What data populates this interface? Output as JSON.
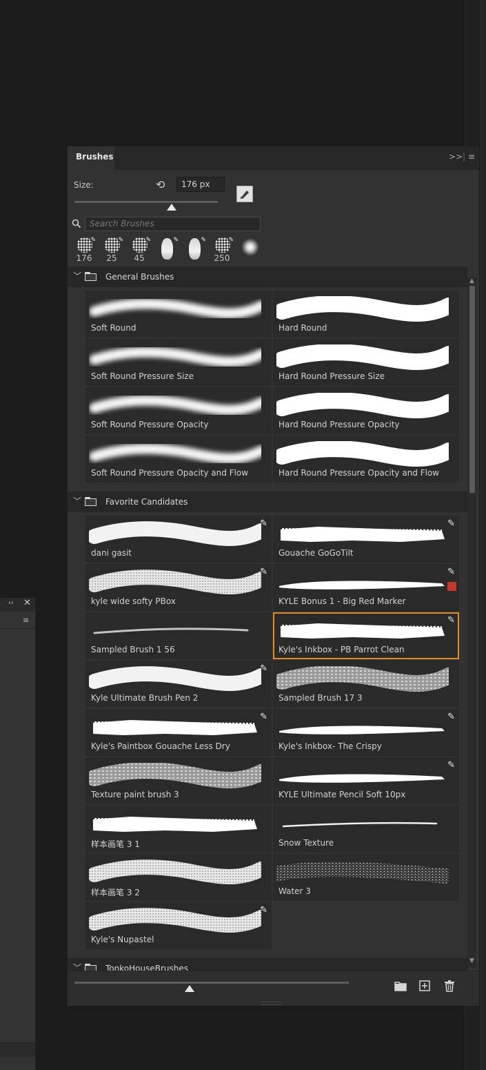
{
  "panel": {
    "title": "Brushes",
    "expand_symbol": ">>",
    "divider_symbol": "|",
    "menu_symbol": "≡"
  },
  "size": {
    "label": "Size:",
    "value": "176 px",
    "slider_fraction": 0.68
  },
  "search": {
    "placeholder": "Search Brushes"
  },
  "recent_brushes": [
    {
      "size": "176",
      "icon": "splatter-brush-icon"
    },
    {
      "size": "25",
      "icon": "splatter-brush-icon"
    },
    {
      "size": "45",
      "icon": "scatter-brush-icon"
    },
    {
      "size": "",
      "icon": "bristle-brush-icon"
    },
    {
      "size": "",
      "icon": "bristle-brush-icon"
    },
    {
      "size": "250",
      "icon": "leaf-brush-icon"
    },
    {
      "size": "",
      "icon": "soft-round-brush-icon"
    }
  ],
  "groups": [
    {
      "name": "General Brushes",
      "brushes": [
        {
          "name": "Soft Round",
          "style": "soft",
          "pen": false
        },
        {
          "name": "Hard Round",
          "style": "hard",
          "pen": false
        },
        {
          "name": "Soft Round Pressure Size",
          "style": "soft",
          "pen": false
        },
        {
          "name": "Hard Round Pressure Size",
          "style": "hard",
          "pen": false
        },
        {
          "name": "Soft Round Pressure Opacity",
          "style": "soft",
          "pen": false
        },
        {
          "name": "Hard Round Pressure Opacity",
          "style": "hard",
          "pen": false
        },
        {
          "name": "Soft Round Pressure Opacity and Flow",
          "style": "soft",
          "pen": false
        },
        {
          "name": "Hard Round Pressure Opacity and Flow",
          "style": "hard",
          "pen": false
        }
      ]
    },
    {
      "name": "Favorite Candidates",
      "brushes": [
        {
          "name": "dani gasit",
          "style": "marker",
          "pen": true
        },
        {
          "name": "Gouache GoGoTilt",
          "style": "rough",
          "pen": true
        },
        {
          "name": "kyle wide softy PBox",
          "style": "grainy",
          "pen": true
        },
        {
          "name": "KYLE Bonus 1 - Big Red Marker",
          "style": "taper",
          "pen": true,
          "red": true
        },
        {
          "name": "Sampled Brush 1 56",
          "style": "thin",
          "pen": false
        },
        {
          "name": "Kyle's Inkbox - PB Parrot Clean",
          "style": "rough",
          "pen": true,
          "selected": true
        },
        {
          "name": "Kyle Ultimate Brush Pen 2",
          "style": "marker",
          "pen": true
        },
        {
          "name": "Sampled Brush 17 3",
          "style": "texture",
          "pen": false
        },
        {
          "name": "Kyle's Paintbox Gouache Less Dry",
          "style": "rough",
          "pen": true
        },
        {
          "name": "Kyle's Inkbox- The Crispy",
          "style": "taper",
          "pen": true
        },
        {
          "name": "Texture paint brush 3",
          "style": "texture",
          "pen": false
        },
        {
          "name": "KYLE Ultimate Pencil Soft 10px",
          "style": "taper",
          "pen": true
        },
        {
          "name": "样本画笔 3 1",
          "style": "rough",
          "pen": false
        },
        {
          "name": "Snow Texture",
          "style": "hairline",
          "pen": false
        },
        {
          "name": "样本画笔 3 2",
          "style": "grainy",
          "pen": false
        },
        {
          "name": "Water 3",
          "style": "speckle",
          "pen": false
        },
        {
          "name": "Kyle's Nupastel",
          "style": "grainy",
          "pen": true
        }
      ]
    },
    {
      "name": "TonkoHouseBrushes",
      "brushes": []
    }
  ],
  "bottom": {
    "slider_fraction": 0.42
  },
  "colors": {
    "panel_bg": "#323232",
    "selection": "#e08b2d",
    "red_marker": "#c03a2b"
  }
}
